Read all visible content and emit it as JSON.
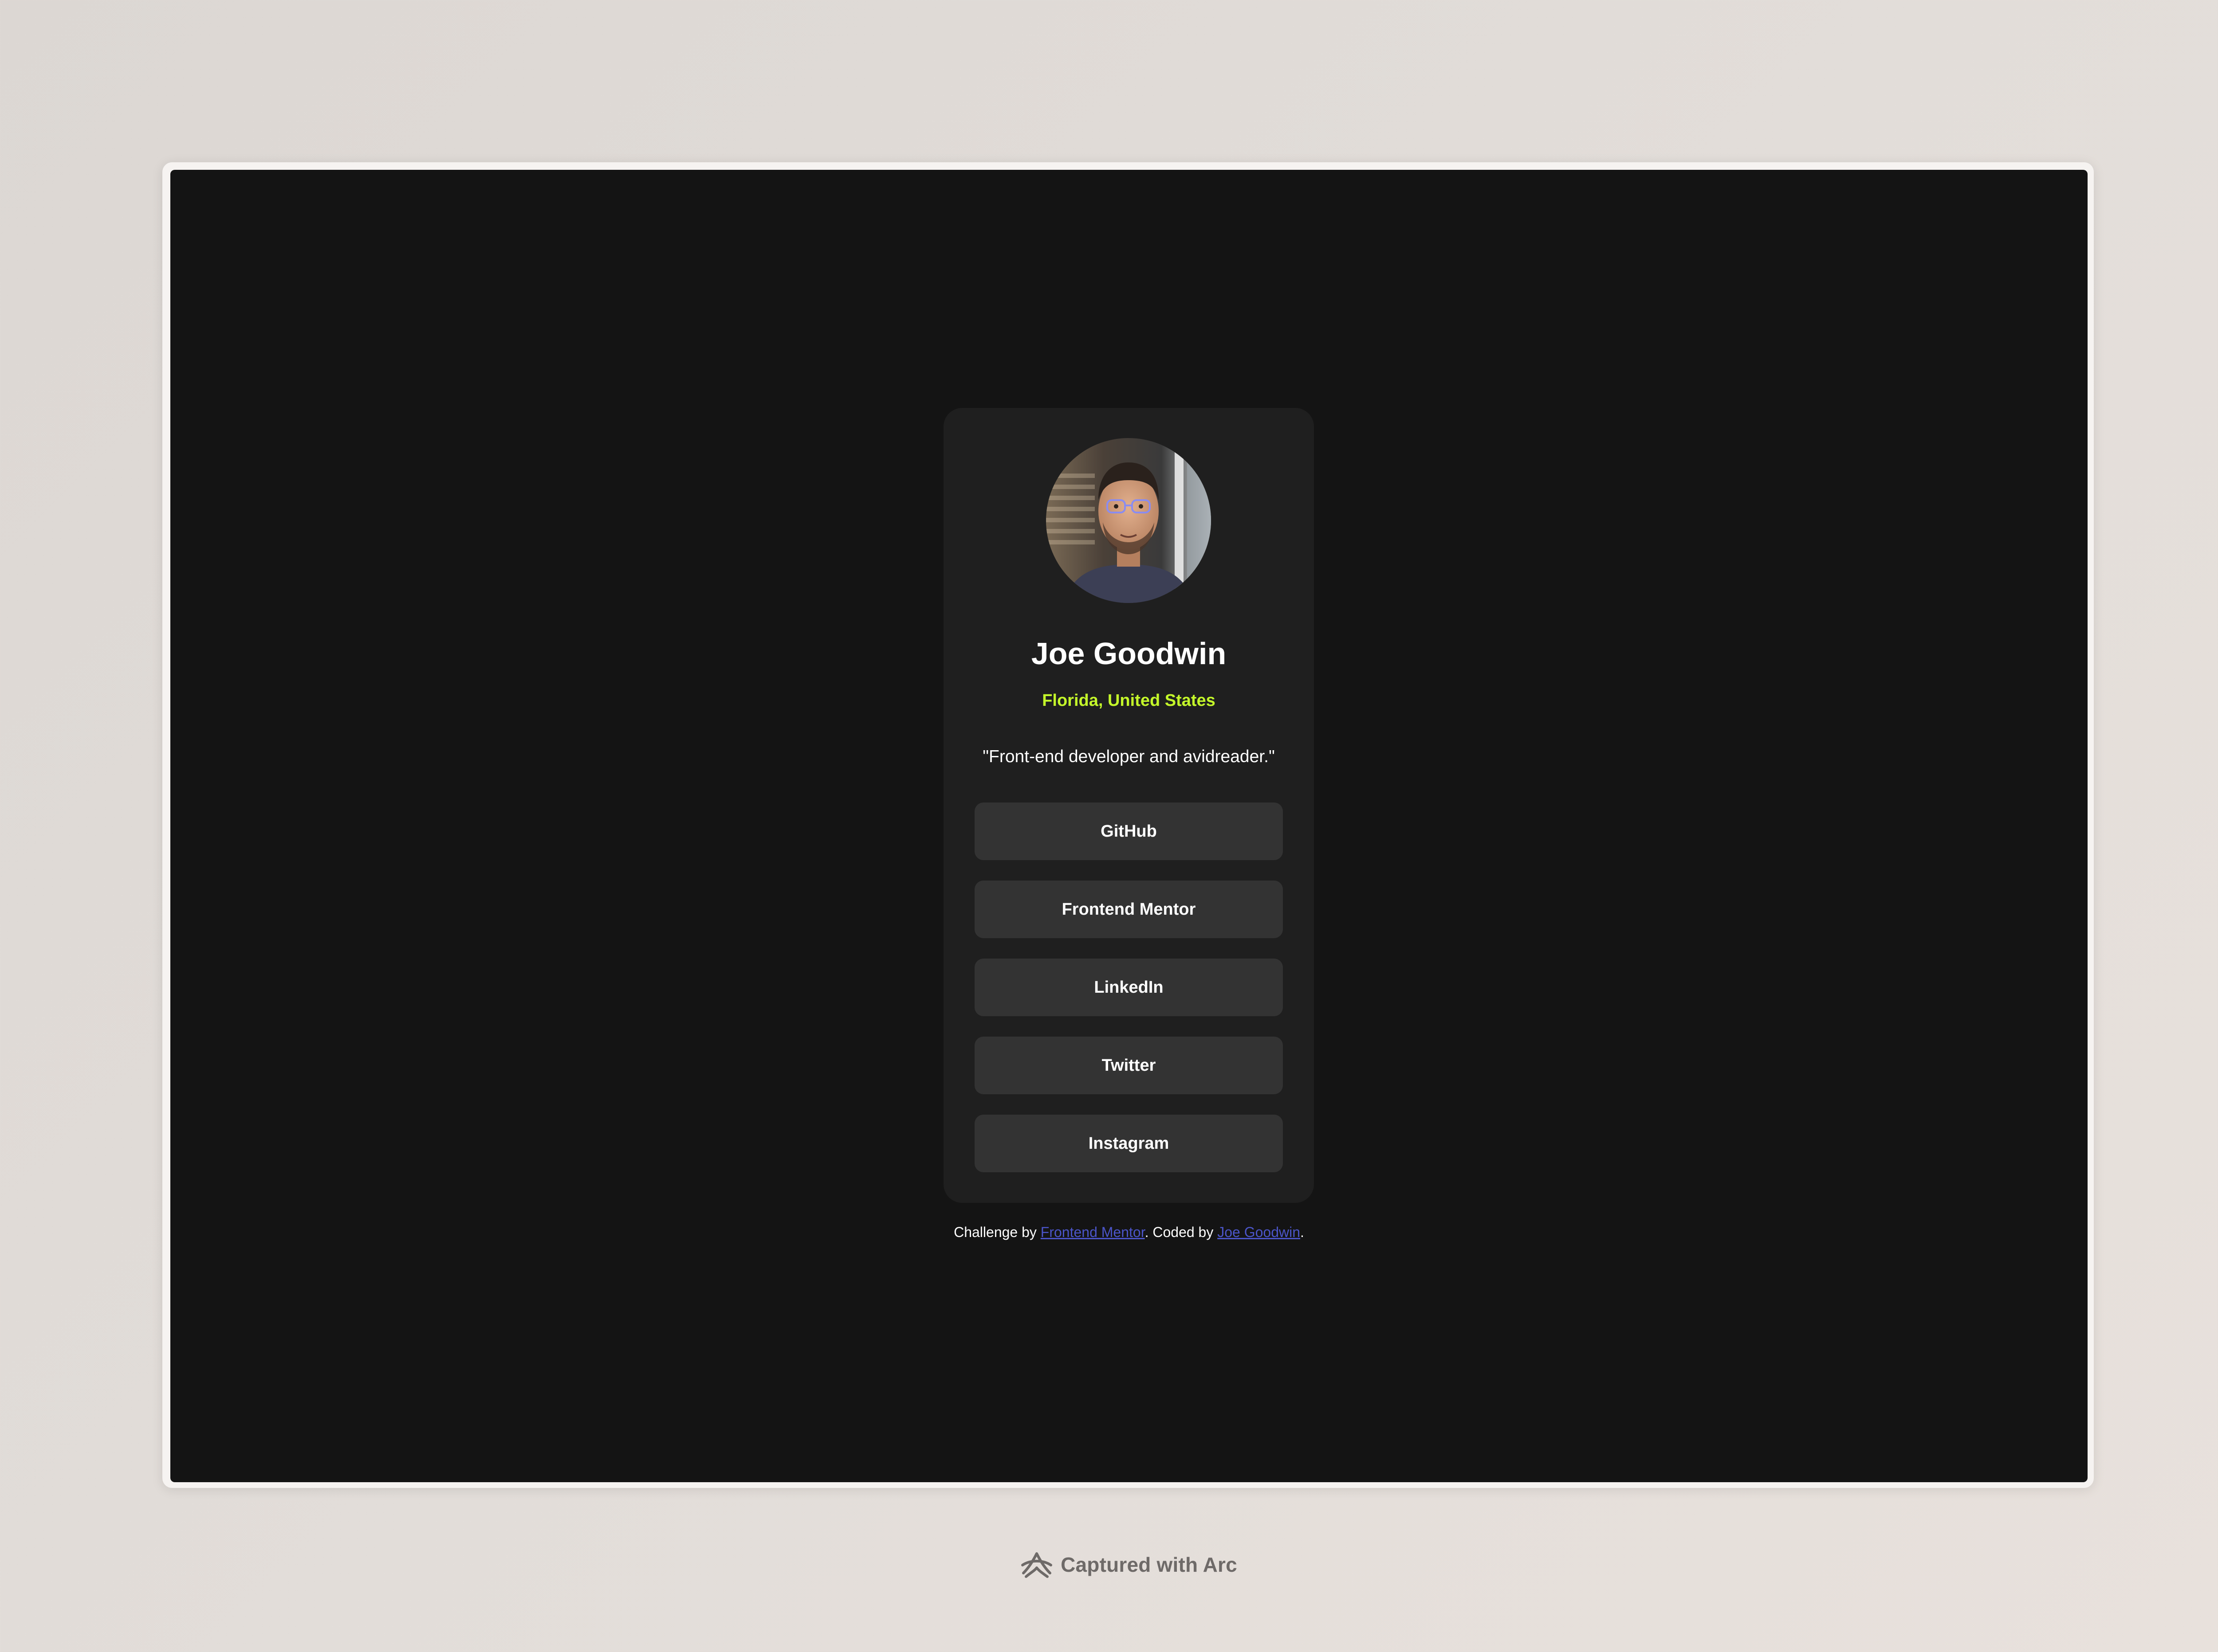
{
  "profile": {
    "avatar_alt": "Joe Goodwin",
    "name": "Joe Goodwin",
    "location": "Florida, United States",
    "bio": "\"Front-end developer and avidreader.\""
  },
  "links": [
    {
      "label": "GitHub"
    },
    {
      "label": "Frontend Mentor"
    },
    {
      "label": "LinkedIn"
    },
    {
      "label": "Twitter"
    },
    {
      "label": "Instagram"
    }
  ],
  "footer": {
    "prefix": "Challenge by ",
    "challenge_link": "Frontend Mentor",
    "middle": ". Coded by ",
    "author_link": "Joe Goodwin",
    "suffix": "."
  },
  "capture": {
    "label": "Captured with Arc",
    "icon": "arc-logo-icon"
  },
  "colors": {
    "page_background": "#141414",
    "card_background": "#1f1f1f",
    "button_background": "#333333",
    "accent_green": "#c4f82a",
    "link_blue": "#4b55c9"
  }
}
